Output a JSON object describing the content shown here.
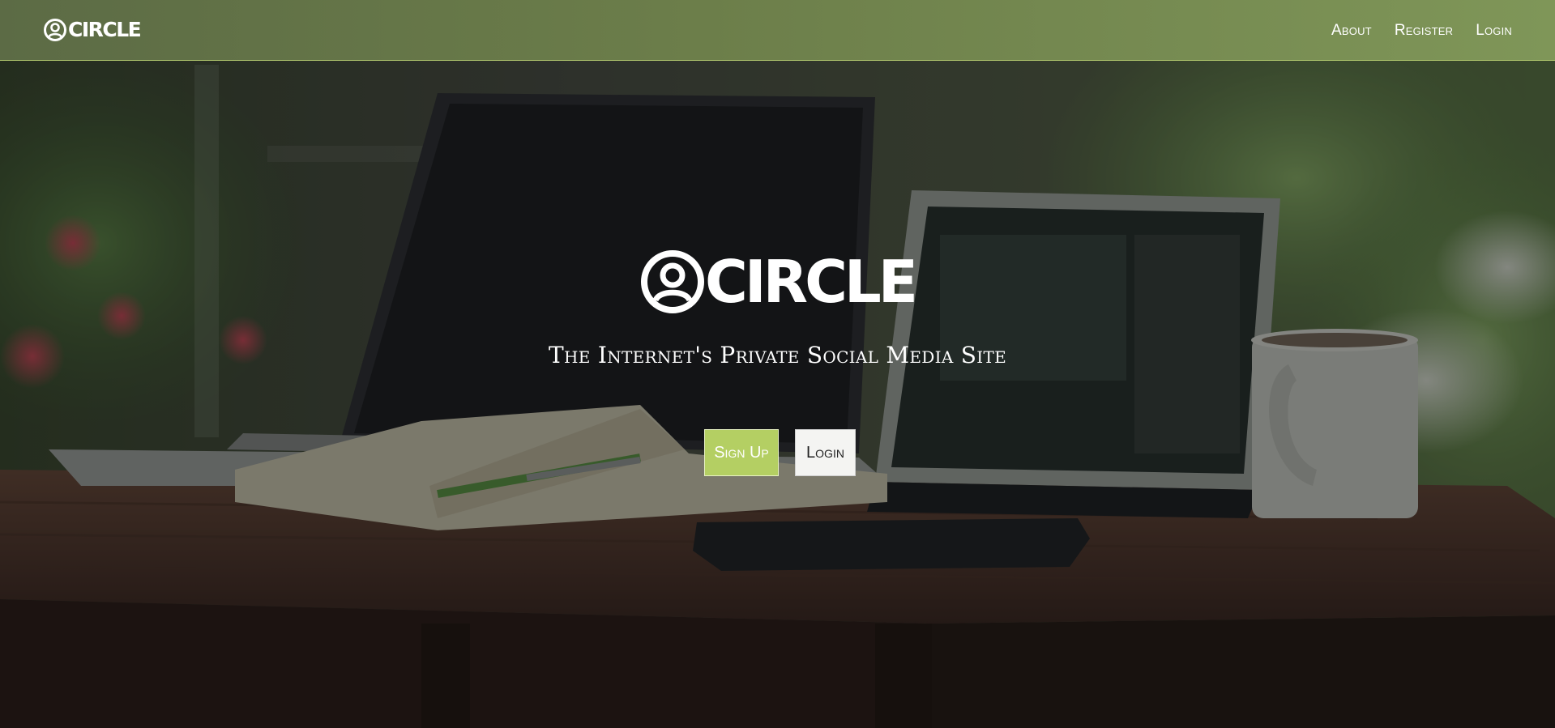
{
  "brand": {
    "name": "CIRCLE",
    "icon": "user-circle-icon",
    "accent_color": "#b4cf63"
  },
  "nav": {
    "links": [
      {
        "label": "About"
      },
      {
        "label": "Register"
      },
      {
        "label": "Login"
      }
    ]
  },
  "hero": {
    "title": "CIRCLE",
    "tagline": "The Internet's Private Social Media Site",
    "background": "laptop-tablet-coffee-table-photo",
    "buttons": {
      "signup": "Sign Up",
      "login": "Login"
    }
  },
  "colors": {
    "navbar": "#6c7e4a",
    "signup_button": "#b4cf63",
    "login_button": "#f4f4f2"
  }
}
